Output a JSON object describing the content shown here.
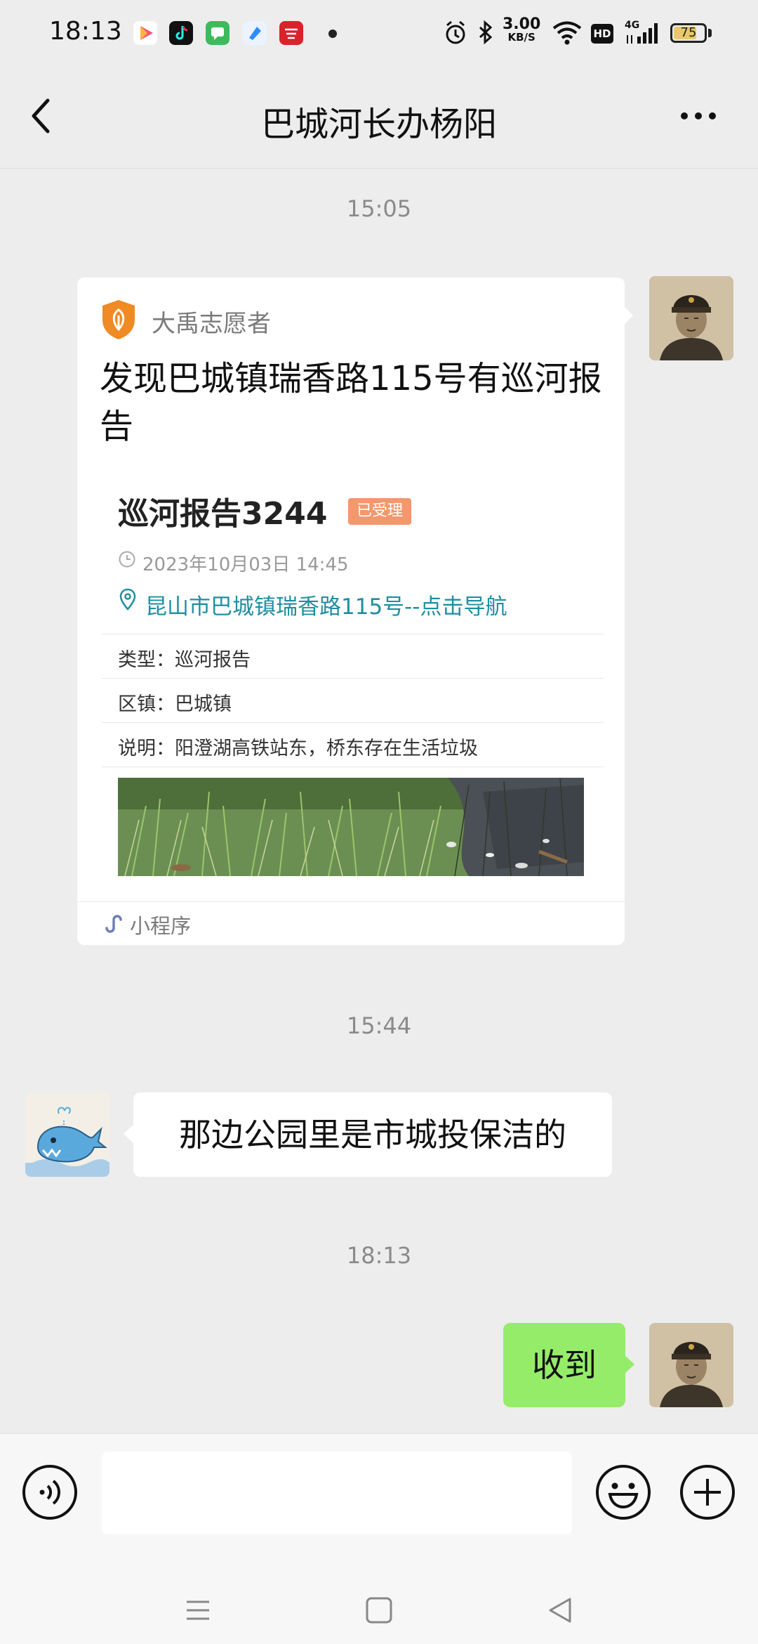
{
  "status_bar": {
    "time": "18:13",
    "net_speed_value": "3.00",
    "net_speed_unit": "KB/S",
    "hd": "HD",
    "network": "4G",
    "battery": "75",
    "battery_level_percent": 75,
    "icons": [
      "video-app-icon",
      "douyin-app-icon",
      "messages-app-icon",
      "blue-app-icon",
      "red-app-icon",
      "alarm-icon",
      "bluetooth-icon",
      "wifi-icon",
      "signal-icon"
    ]
  },
  "header": {
    "title": "巴城河长办杨阳",
    "back_icon": "chevron-left-icon",
    "more_icon": "more-dots-icon"
  },
  "messages": {
    "timestamp_1": "15:05",
    "timestamp_2": "15:44",
    "timestamp_3": "18:13",
    "mini_program": {
      "source": "大禹志愿者",
      "title": "发现巴城镇瑞香路115号有巡河报告",
      "report_title": "巡河报告3244",
      "status": "已受理",
      "time": "2023年10月03日 14:45",
      "location": "昆山市巴城镇瑞香路115号--点击导航",
      "type_label": "类型：",
      "type_value": "巡河报告",
      "district_label": "区镇：",
      "district_value": "巴城镇",
      "desc_label": "说明：",
      "desc_value": "阳澄湖高铁站东，桥东存在生活垃圾",
      "footer": "小程序"
    },
    "received_text": "那边公园里是市城投保洁的",
    "sent_text": "收到"
  },
  "input_bar": {
    "placeholder": "",
    "voice_icon": "voice-icon",
    "emoji_icon": "emoji-icon",
    "plus_icon": "plus-icon"
  },
  "colors": {
    "background": "#ededed",
    "sent_bubble": "#95ec69",
    "status_tag": "#f4976c",
    "location_link": "#1d8fa0",
    "volunteer_badge": "#f08a24"
  }
}
